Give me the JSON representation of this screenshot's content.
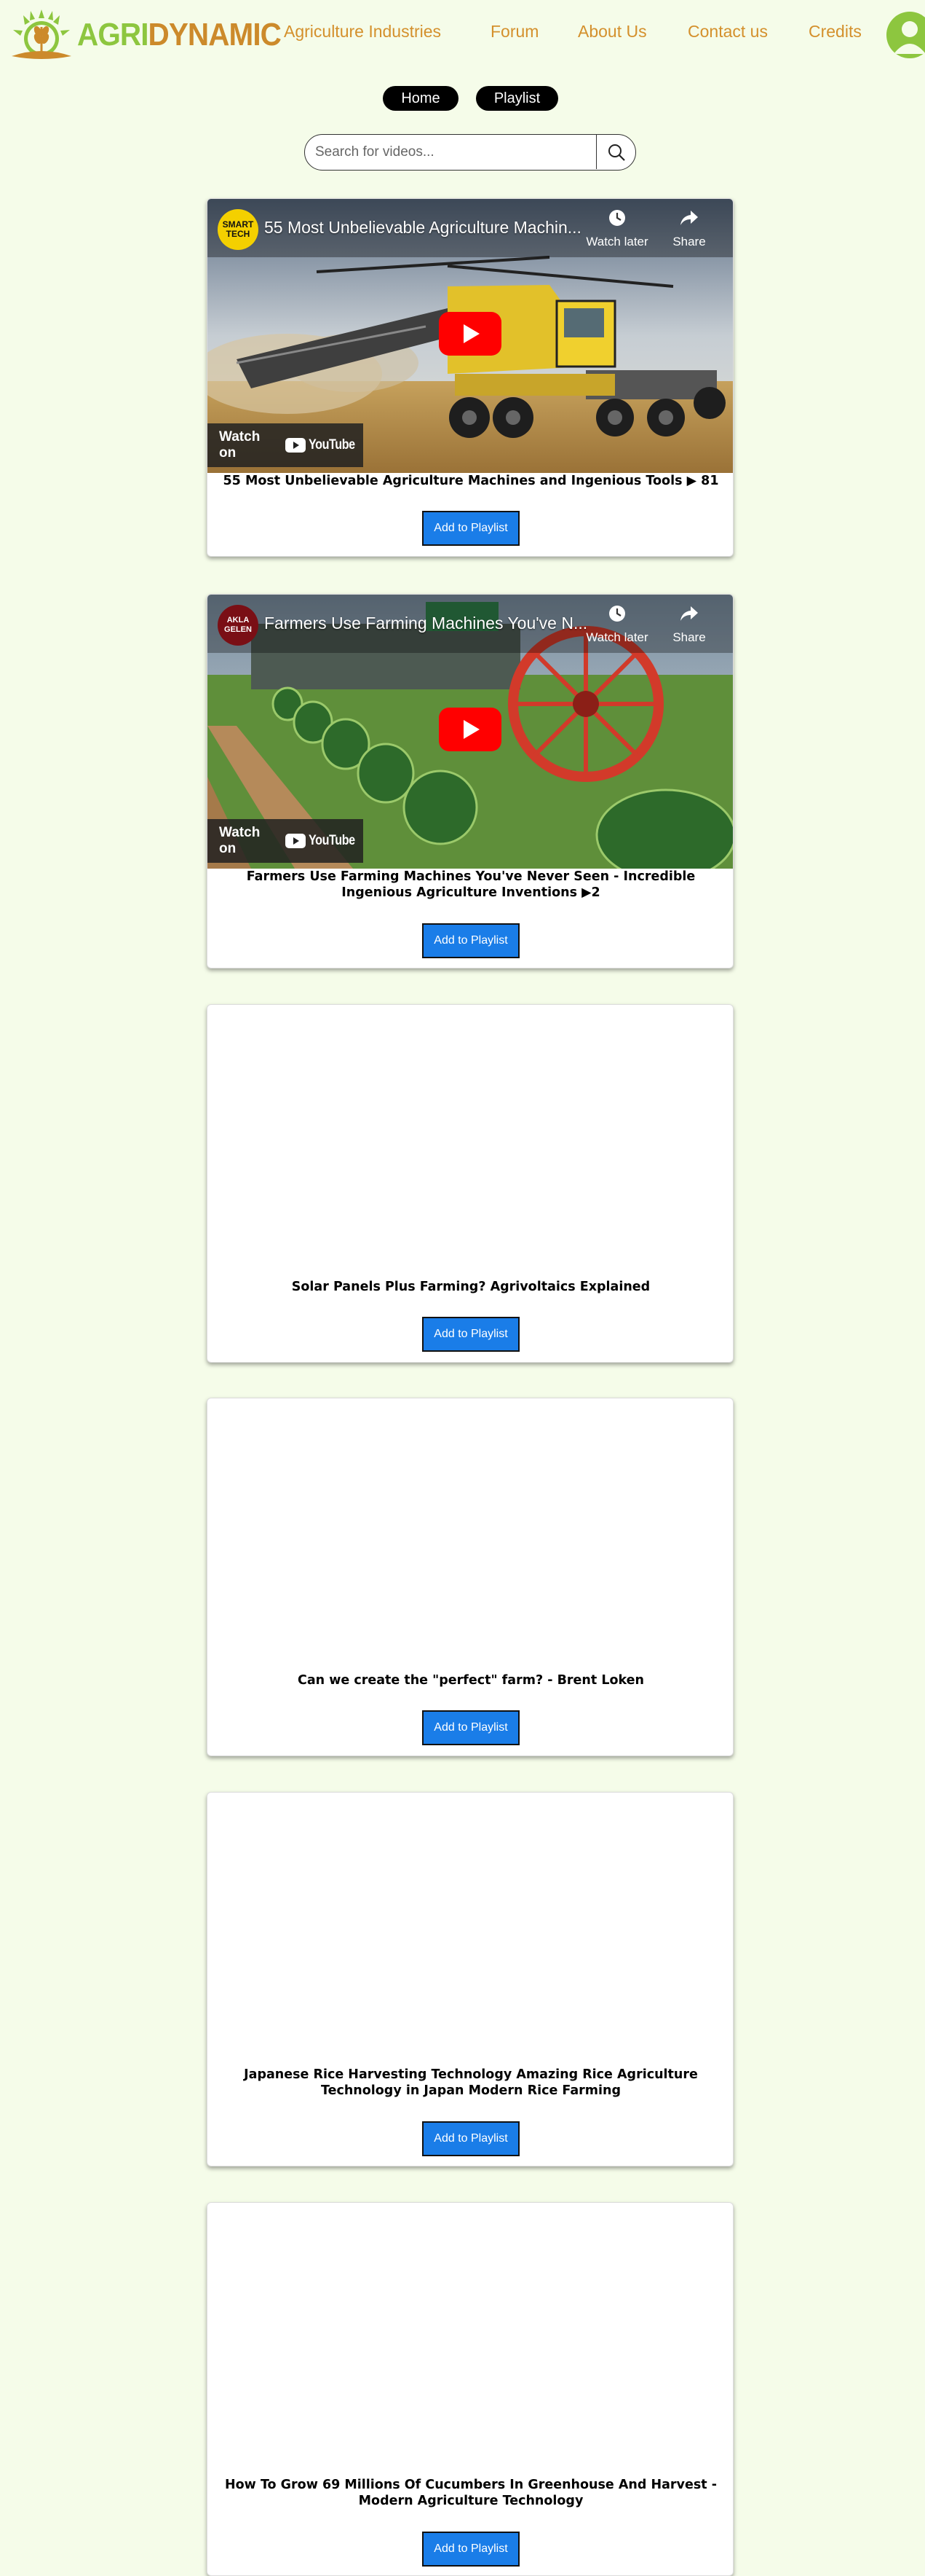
{
  "header": {
    "logo": {
      "agri": "AGRI",
      "dynamic": "DYNAMIC"
    },
    "nav": [
      {
        "label": "Agriculture Industries"
      },
      {
        "label": "Forum"
      },
      {
        "label": "About Us"
      },
      {
        "label": "Contact us"
      },
      {
        "label": "Credits"
      }
    ],
    "avatar_icon": "user-avatar-icon"
  },
  "pills": {
    "home": "Home",
    "playlist": "Playlist"
  },
  "search": {
    "placeholder": "Search for videos...",
    "icon": "search-icon"
  },
  "videos": [
    {
      "title": "55 Most Unbelievable Agriculture Machines and Ingenious Tools ▶ 81",
      "embed": {
        "channel": "SMART TECH",
        "title": "55 Most Unbelievable Agriculture Machin...",
        "watch_later": "Watch later",
        "share": "Share",
        "watch_on": "Watch on",
        "youtube": "YouTube"
      },
      "button": "Add to Playlist"
    },
    {
      "title": "Farmers Use Farming Machines You've Never Seen - Incredible Ingenious Agriculture Inventions ▶2",
      "embed": {
        "channel": "AKLA GELEN",
        "title": "Farmers Use Farming Machines You've N...",
        "watch_later": "Watch later",
        "share": "Share",
        "watch_on": "Watch on",
        "youtube": "YouTube"
      },
      "button": "Add to Playlist"
    },
    {
      "title": "Solar Panels Plus Farming? Agrivoltaics Explained",
      "button": "Add to Playlist"
    },
    {
      "title": "Can we create the \"perfect\" farm? - Brent Loken",
      "button": "Add to Playlist"
    },
    {
      "title": "Japanese Rice Harvesting Technology Amazing Rice Agriculture Technology in Japan Modern Rice Farming",
      "button": "Add to Playlist"
    },
    {
      "title": "How To Grow 69 Millions Of Cucumbers In Greenhouse And Harvest - Modern Agriculture Technology",
      "button": "Add to Playlist"
    }
  ],
  "colors": {
    "background": "#f5fce9",
    "nav_text": "#d4902c",
    "logo_green": "#8dc63f",
    "logo_orange": "#cc8a2b",
    "button_blue": "#1a7de8",
    "youtube_red": "#ff0000"
  }
}
